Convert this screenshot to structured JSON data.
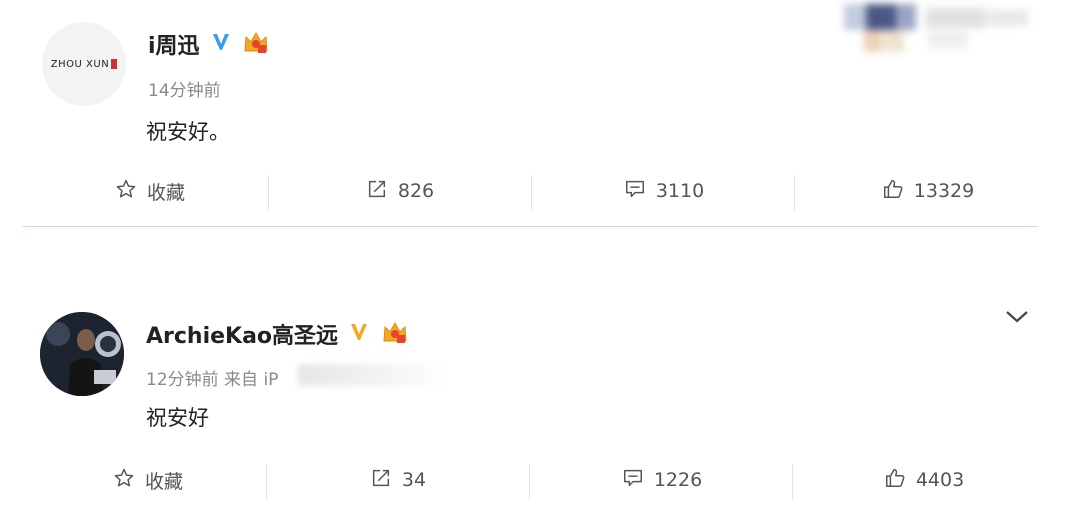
{
  "posts": [
    {
      "username": "i周迅",
      "avatar_text": "ZHOU XUN",
      "time": "14分钟前",
      "content": "祝安好。",
      "actions": {
        "favorite_label": "收藏",
        "repost_count": "826",
        "comment_count": "3110",
        "like_count": "13329"
      }
    },
    {
      "username": "ArchieKao高圣远",
      "time": "12分钟前",
      "source": "来自 iP",
      "content": "祝安好",
      "actions": {
        "favorite_label": "收藏",
        "repost_count": "34",
        "comment_count": "1226",
        "like_count": "4403"
      }
    }
  ],
  "colors": {
    "verified_badge": "#3a9bea",
    "crown_badge": "#f2a922",
    "divider": "#f0d0cd"
  },
  "icons": [
    "star-icon",
    "repost-icon",
    "comment-icon",
    "like-icon",
    "verified-icon",
    "crown-badge-icon",
    "chevron-down-icon"
  ]
}
